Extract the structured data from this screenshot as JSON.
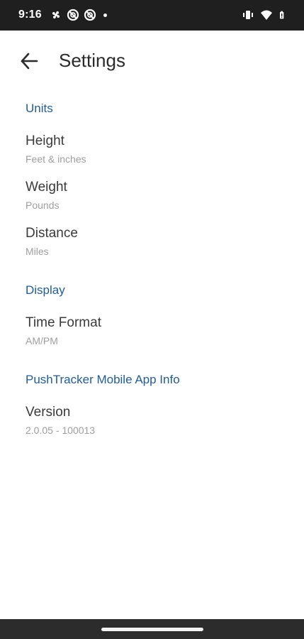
{
  "status_bar": {
    "time": "9:16",
    "left_icons": [
      "pinwheel-icon",
      "blocked-notification-icon",
      "blocked-notification-icon",
      "dot-icon"
    ],
    "right_icons": [
      "vibrate-icon",
      "wifi-icon",
      "battery-icon"
    ]
  },
  "app_bar": {
    "title": "Settings",
    "back_icon": "arrow-back-icon"
  },
  "sections": [
    {
      "header": "Units",
      "items": [
        {
          "title": "Height",
          "summary": "Feet & inches"
        },
        {
          "title": "Weight",
          "summary": "Pounds"
        },
        {
          "title": "Distance",
          "summary": "Miles"
        }
      ]
    },
    {
      "header": "Display",
      "items": [
        {
          "title": "Time Format",
          "summary": "AM/PM"
        }
      ]
    },
    {
      "header": "PushTracker Mobile App Info",
      "items": [
        {
          "title": "Version",
          "summary": "2.0.05 - 100013"
        }
      ]
    }
  ],
  "colors": {
    "status_bar": "#1f1f1f",
    "accent": "#1f5c9c",
    "title_text": "#3a3a3a",
    "summary_text": "#9e9e9e"
  }
}
